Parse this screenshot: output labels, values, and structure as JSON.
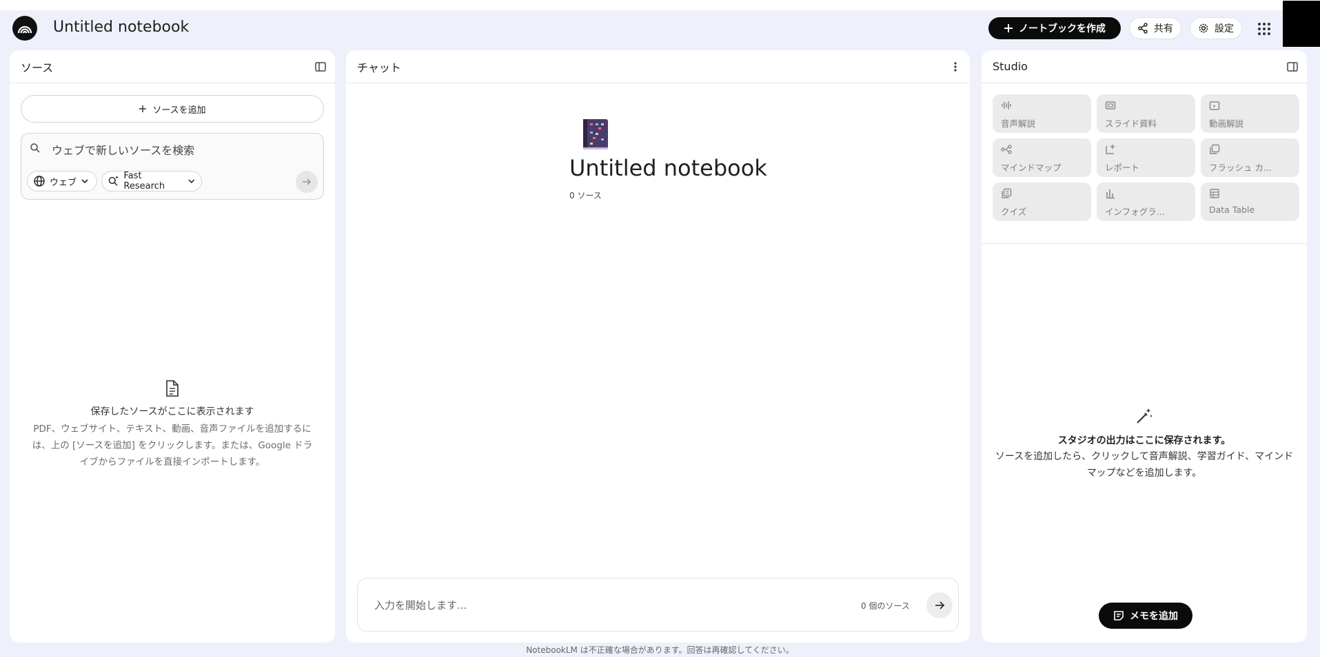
{
  "header": {
    "title": "Untitled notebook",
    "create_label": "ノートブックを作成",
    "share_label": "共有",
    "settings_label": "設定"
  },
  "sources": {
    "title": "ソース",
    "add_label": "ソースを追加",
    "search_placeholder": "ウェブで新しいソースを検索",
    "chip_web": "ウェブ",
    "chip_research": "Fast Research",
    "empty_title": "保存したソースがここに表示されます",
    "empty_desc_1": "PDF、ウェブサイト、テキスト、動画、音声ファイルを追加するに",
    "empty_desc_2": "は、上の [ソースを追加] をクリックします。または、Google ドラ",
    "empty_desc_3": "イブからファイルを直接インポートします。"
  },
  "chat": {
    "title": "チャット",
    "notebook_title": "Untitled notebook",
    "source_count": "0 ソース",
    "input_placeholder": "入力を開始します...",
    "input_source_count": "0 個のソース"
  },
  "studio": {
    "title": "Studio",
    "tiles": [
      {
        "label": "音声解説",
        "icon": "audio-waveform-icon"
      },
      {
        "label": "スライド資料",
        "icon": "slides-icon"
      },
      {
        "label": "動画解説",
        "icon": "video-icon"
      },
      {
        "label": "マインドマップ",
        "icon": "mind-map-icon"
      },
      {
        "label": "レポート",
        "icon": "report-icon"
      },
      {
        "label": "フラッシュ カ...",
        "icon": "flashcards-icon"
      },
      {
        "label": "クイズ",
        "icon": "quiz-icon"
      },
      {
        "label": "インフォグラ...",
        "icon": "infographic-icon"
      },
      {
        "label": "Data Table",
        "icon": "table-icon"
      }
    ],
    "empty_title": "スタジオの出力はここに保存されます。",
    "empty_desc_1": "ソースを追加したら、クリックして音声解説、学習ガイド、マインド",
    "empty_desc_2": "マップなどを追加します。",
    "memo_label": "メモを追加"
  },
  "footer": {
    "disclaimer": "NotebookLM は不正確な場合があります。回答は再確認してください。"
  }
}
